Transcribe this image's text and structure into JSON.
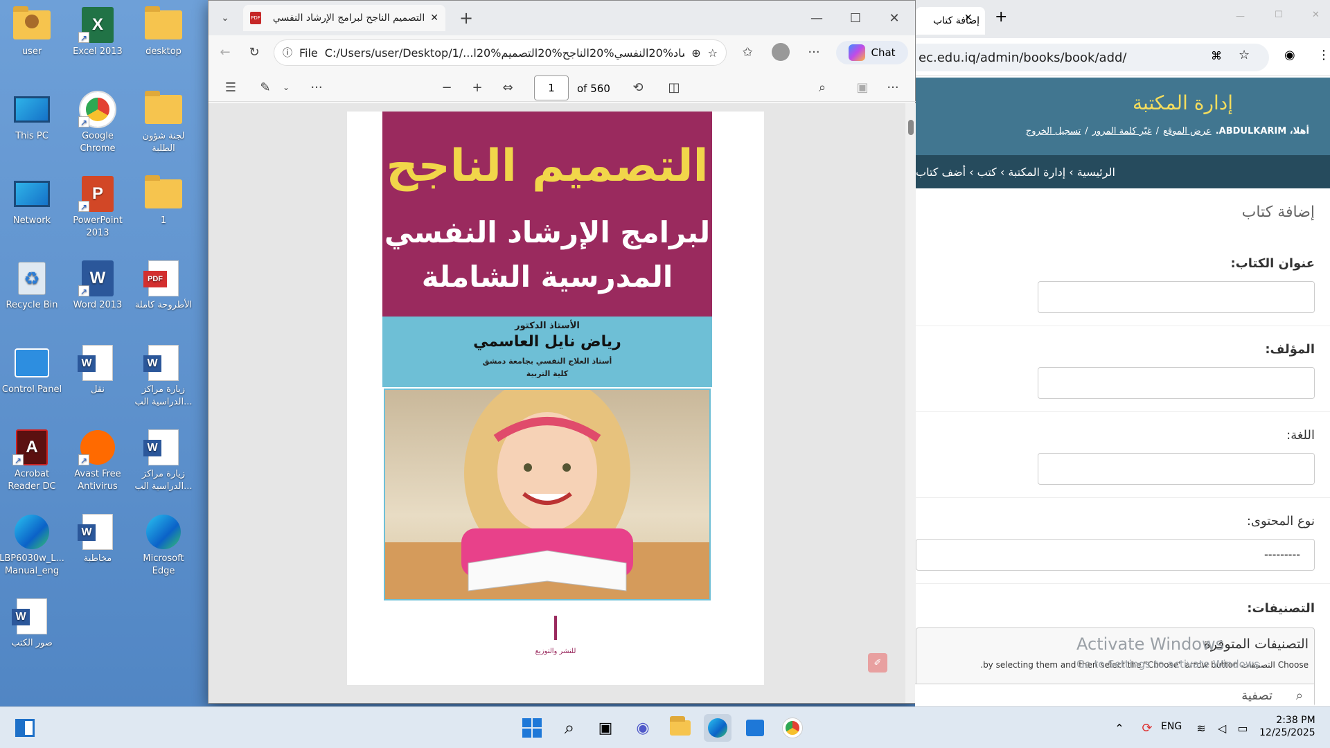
{
  "desktop": {
    "icons": [
      {
        "label": "user",
        "kind": "user"
      },
      {
        "label": "Excel 2013",
        "kind": "excel"
      },
      {
        "label": "desktop",
        "kind": "folder"
      },
      {
        "label": "This PC",
        "kind": "pc"
      },
      {
        "label": "Google Chrome",
        "kind": "chrome"
      },
      {
        "label": "لجنة شؤون الطلبة",
        "kind": "folder"
      },
      {
        "label": "Network",
        "kind": "network"
      },
      {
        "label": "PowerPoint 2013",
        "kind": "powerpoint"
      },
      {
        "label": "1",
        "kind": "folder"
      },
      {
        "label": "Recycle Bin",
        "kind": "recycle"
      },
      {
        "label": "Word 2013",
        "kind": "word"
      },
      {
        "label": "الأطروحة كاملة",
        "kind": "pdf"
      },
      {
        "label": "Control Panel",
        "kind": "control"
      },
      {
        "label": "نقل",
        "kind": "worddoc"
      },
      {
        "label": "زيارة مراكز الدراسية الب...",
        "kind": "worddoc"
      },
      {
        "label": "Acrobat Reader DC",
        "kind": "acrobat"
      },
      {
        "label": "Avast Free Antivirus",
        "kind": "avast"
      },
      {
        "label": "زيارة مراكز الدراسية الب...",
        "kind": "worddoc"
      },
      {
        "label": "LBP6030w_L... Manual_eng",
        "kind": "edge"
      },
      {
        "label": "مخاطبة",
        "kind": "worddoc"
      },
      {
        "label": "Microsoft Edge",
        "kind": "edge"
      },
      {
        "label": "صور الكتب",
        "kind": "worddoc"
      }
    ]
  },
  "pdf_window": {
    "tab_title": "التصميم الناجح لبرامج الإرشاد النفسي",
    "tab_badge": "PDF",
    "address_prefix": "File",
    "address": "C:/Users/user/Desktop/1/...l20%لبرامج%20الإرشاد%20النفسي%20الناجح%20التصميم",
    "chat_label": "Chat",
    "page_number": "1",
    "page_total": "of 560",
    "cover": {
      "title_line1": "التصميم الناجح",
      "title_line2": "لبرامج الإرشاد النفسي",
      "title_line3": "المدرسية الشاملة",
      "author_title": "الأستاذ الدكتور",
      "author_name": "رياض نايل العاسمي",
      "author_role": "أستاذ العلاج النفسي بجامعة دمشق",
      "author_faculty": "كلية التربية",
      "publisher": "للنشر والتوزيع"
    }
  },
  "admin_window": {
    "tab_title": "إضافة كتاب",
    "address": "ec.edu.iq/admin/books/book/add/",
    "site_title": "إدارة المكتبة",
    "user_greeting": "أهلا، ABDULKARIM.",
    "link_view_site": "عرض الموقع",
    "link_change_password": "غيّر كلمة المرور",
    "link_logout": "تسجيل الخروج",
    "breadcrumbs": "الرئيسية › إدارة المكتبة › كتب › أضف كتاب",
    "page_heading": "إضافة كتاب",
    "fields": {
      "title_label": "عنوان الكتاب:",
      "author_label": "المؤلف:",
      "language_label": "اللغة:",
      "content_type_label": "نوع المحتوى:",
      "content_type_value": "---------",
      "categories_label": "التصنيفات:",
      "available_categories": "التصنيفات المتوفرة",
      "choose_help": "Choose التصنيفات by selecting them and then select the \"Choose\" arrow button.",
      "filter_placeholder": "تصفية"
    },
    "activation_line1": "Activate Windows",
    "activation_line2": "Go to Settings to activate Windows."
  },
  "taskbar": {
    "language": "ENG",
    "time": "2:38 PM",
    "date": "12/25/2025"
  }
}
